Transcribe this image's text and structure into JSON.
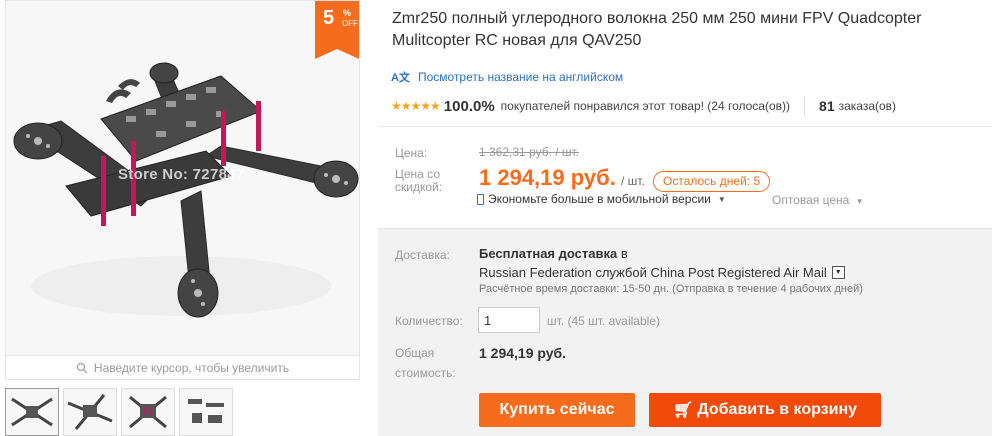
{
  "product": {
    "title": "Zmr250 полный углеродного волокна 250 мм 250 мини FPV Quadcopter Mulitcopter RC новая для QAV250",
    "translate_link": "Посмотреть название на английском",
    "rating_percent": "100.0%",
    "rating_text": "покупателей понравился этот товар! (24 голоса(ов))",
    "orders_count": "81",
    "orders_label": "заказа(ов)",
    "stars": 5
  },
  "gallery": {
    "discount": {
      "value": "5",
      "percent": "%",
      "off": "OFF"
    },
    "watermark": "Store No: 727847",
    "zoom_hint": "Наведите курсор, чтобы увеличить",
    "thumbnails": [
      "thumb-1",
      "thumb-2",
      "thumb-3",
      "thumb-4"
    ]
  },
  "price": {
    "old_label": "Цена:",
    "old_price": "1 362,31 руб. / шт.",
    "new_label_line1": "Цена со",
    "new_label_line2": "скидкой:",
    "new_price": "1 294,19 руб.",
    "per_unit": "/ шт.",
    "days_left": "Осталось дней: 5",
    "mobile_saving": "Экономьте больше в мобильной версии",
    "wholesale": "Оптовая цена"
  },
  "shipping": {
    "label": "Доставка:",
    "free": "Бесплатная доставка",
    "in_word": "в",
    "route": "Russian Federation службой China Post Registered Air Mail",
    "estimate": "Расчётное время доставки: 15-50 дн. (Отправка в течение 4 рабочих дней)"
  },
  "quantity": {
    "label": "Количество:",
    "value": "1",
    "available": "шт. (45 шт. available)"
  },
  "total": {
    "label_line1": "Общая",
    "label_line2": "стоимость:",
    "value": "1 294,19 руб."
  },
  "buttons": {
    "buy_now": "Купить сейчас",
    "add_to_cart": "Добавить в корзину"
  },
  "colors": {
    "accent": "#f76b1c",
    "cart": "#f24a08",
    "link": "#2872c5",
    "star": "#f7a51c"
  }
}
